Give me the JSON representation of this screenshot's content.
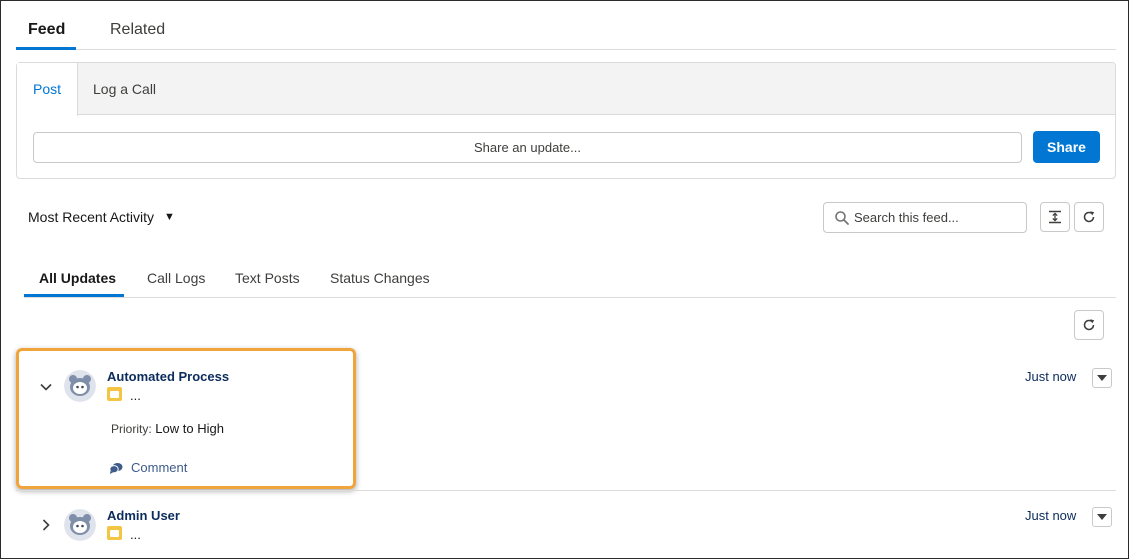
{
  "top_tabs": {
    "feed": "Feed",
    "related": "Related"
  },
  "publisher": {
    "tabs": {
      "post": "Post",
      "log_call": "Log a Call"
    },
    "input_placeholder": "Share an update...",
    "share_label": "Share"
  },
  "sort": {
    "label": "Most Recent Activity"
  },
  "search": {
    "placeholder": "Search this feed..."
  },
  "filter_tabs": {
    "all_updates": "All Updates",
    "call_logs": "Call Logs",
    "text_posts": "Text Posts",
    "status_changes": "Status Changes"
  },
  "feed": {
    "items": [
      {
        "author": "Automated Process",
        "summary": "...",
        "timestamp": "Just now",
        "change_label": "Priority:",
        "change_value": "Low to High",
        "comment_label": "Comment"
      },
      {
        "author": "Admin User",
        "summary": "...",
        "timestamp": "Just now"
      }
    ]
  },
  "icons": {
    "caret": "caret-down-icon",
    "search": "search-icon",
    "collapse": "expand-collapse-icon",
    "refresh": "refresh-icon",
    "chevron_down": "chevron-down-icon",
    "chevron_right": "chevron-right-icon",
    "avatar": "avatar",
    "record": "record-icon",
    "comment": "comment-icon"
  },
  "colors": {
    "accent": "#0176d3",
    "highlight": "#f0a43c",
    "record_icon": "#f4c542"
  }
}
